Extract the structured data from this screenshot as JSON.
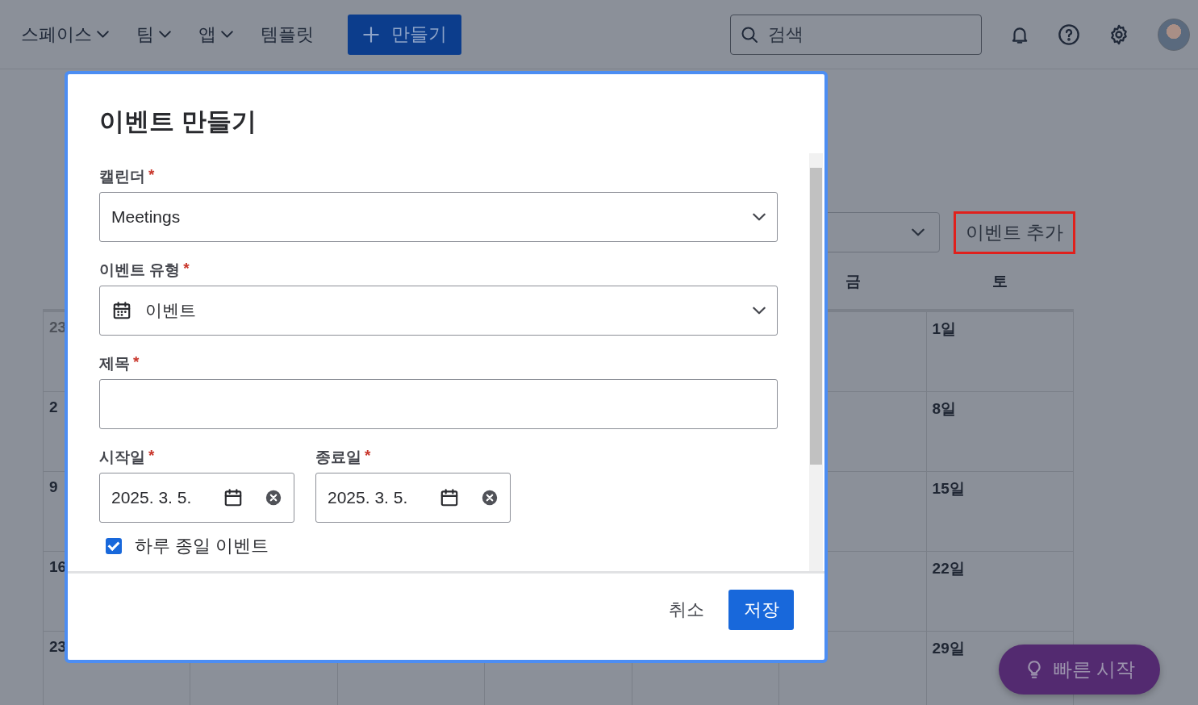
{
  "top_nav": {
    "items": [
      {
        "label": "스페이스",
        "dropdown": true
      },
      {
        "label": "팀",
        "dropdown": true
      },
      {
        "label": "앱",
        "dropdown": true
      },
      {
        "label": "템플릿",
        "dropdown": false
      }
    ],
    "create_button": "만들기",
    "search": {
      "placeholder": "검색"
    }
  },
  "toolbar": {
    "add_event_button": "이벤트 추가"
  },
  "calendar": {
    "weekday_headers": [
      "금",
      "토"
    ],
    "rows": [
      {
        "first_day": "23",
        "first_muted": true,
        "last_day": "1일"
      },
      {
        "first_day": "2",
        "first_muted": false,
        "last_day": "8일"
      },
      {
        "first_day": "9",
        "first_muted": false,
        "last_day": "15일"
      },
      {
        "first_day": "16",
        "first_muted": false,
        "last_day": "22일"
      },
      {
        "first_day": "23",
        "first_muted": false,
        "last_day": "29일"
      }
    ]
  },
  "dialog": {
    "title": "이벤트 만들기",
    "required_mark": "*",
    "fields": [
      {
        "kind": "select",
        "label": "캘린더",
        "required": true,
        "value": "Meetings",
        "has_icon": false
      },
      {
        "kind": "select",
        "label": "이벤트 유형",
        "required": true,
        "value": "이벤트",
        "has_icon": true
      },
      {
        "kind": "text",
        "label": "제목",
        "required": true
      },
      {
        "kind": "dates",
        "items": [
          {
            "label": "시작일",
            "required": true,
            "value": "2025. 3. 5."
          },
          {
            "label": "종료일",
            "required": true,
            "value": "2025. 3. 5."
          }
        ]
      },
      {
        "kind": "checkbox",
        "label": "하루 종일 이벤트",
        "checked": true
      }
    ],
    "cancel_button": "취소",
    "save_button": "저장"
  },
  "quick_start_button": "빠른 시작"
}
